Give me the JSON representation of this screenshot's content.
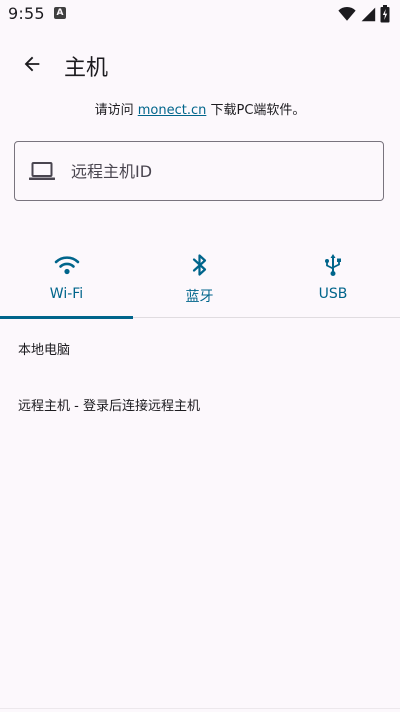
{
  "status_bar": {
    "time": "9:55",
    "notification_badge": "A"
  },
  "app_bar": {
    "title": "主机"
  },
  "visit": {
    "prefix": "请访问 ",
    "link": "monect.cn",
    "suffix": " 下载PC端软件。"
  },
  "host_input": {
    "placeholder": "远程主机ID",
    "value": ""
  },
  "tabs": [
    {
      "label": "Wi-Fi",
      "icon": "wifi-icon",
      "selected": true
    },
    {
      "label": "蓝牙",
      "icon": "bluetooth-icon",
      "selected": false
    },
    {
      "label": "USB",
      "icon": "usb-icon",
      "selected": false
    }
  ],
  "list": [
    {
      "label": "本地电脑"
    },
    {
      "label": "远程主机 - 登录后连接远程主机"
    }
  ],
  "colors": {
    "accent": "#00658b",
    "background": "#fcf8fc",
    "text": "#1c1b1f",
    "outline": "#79747e"
  }
}
